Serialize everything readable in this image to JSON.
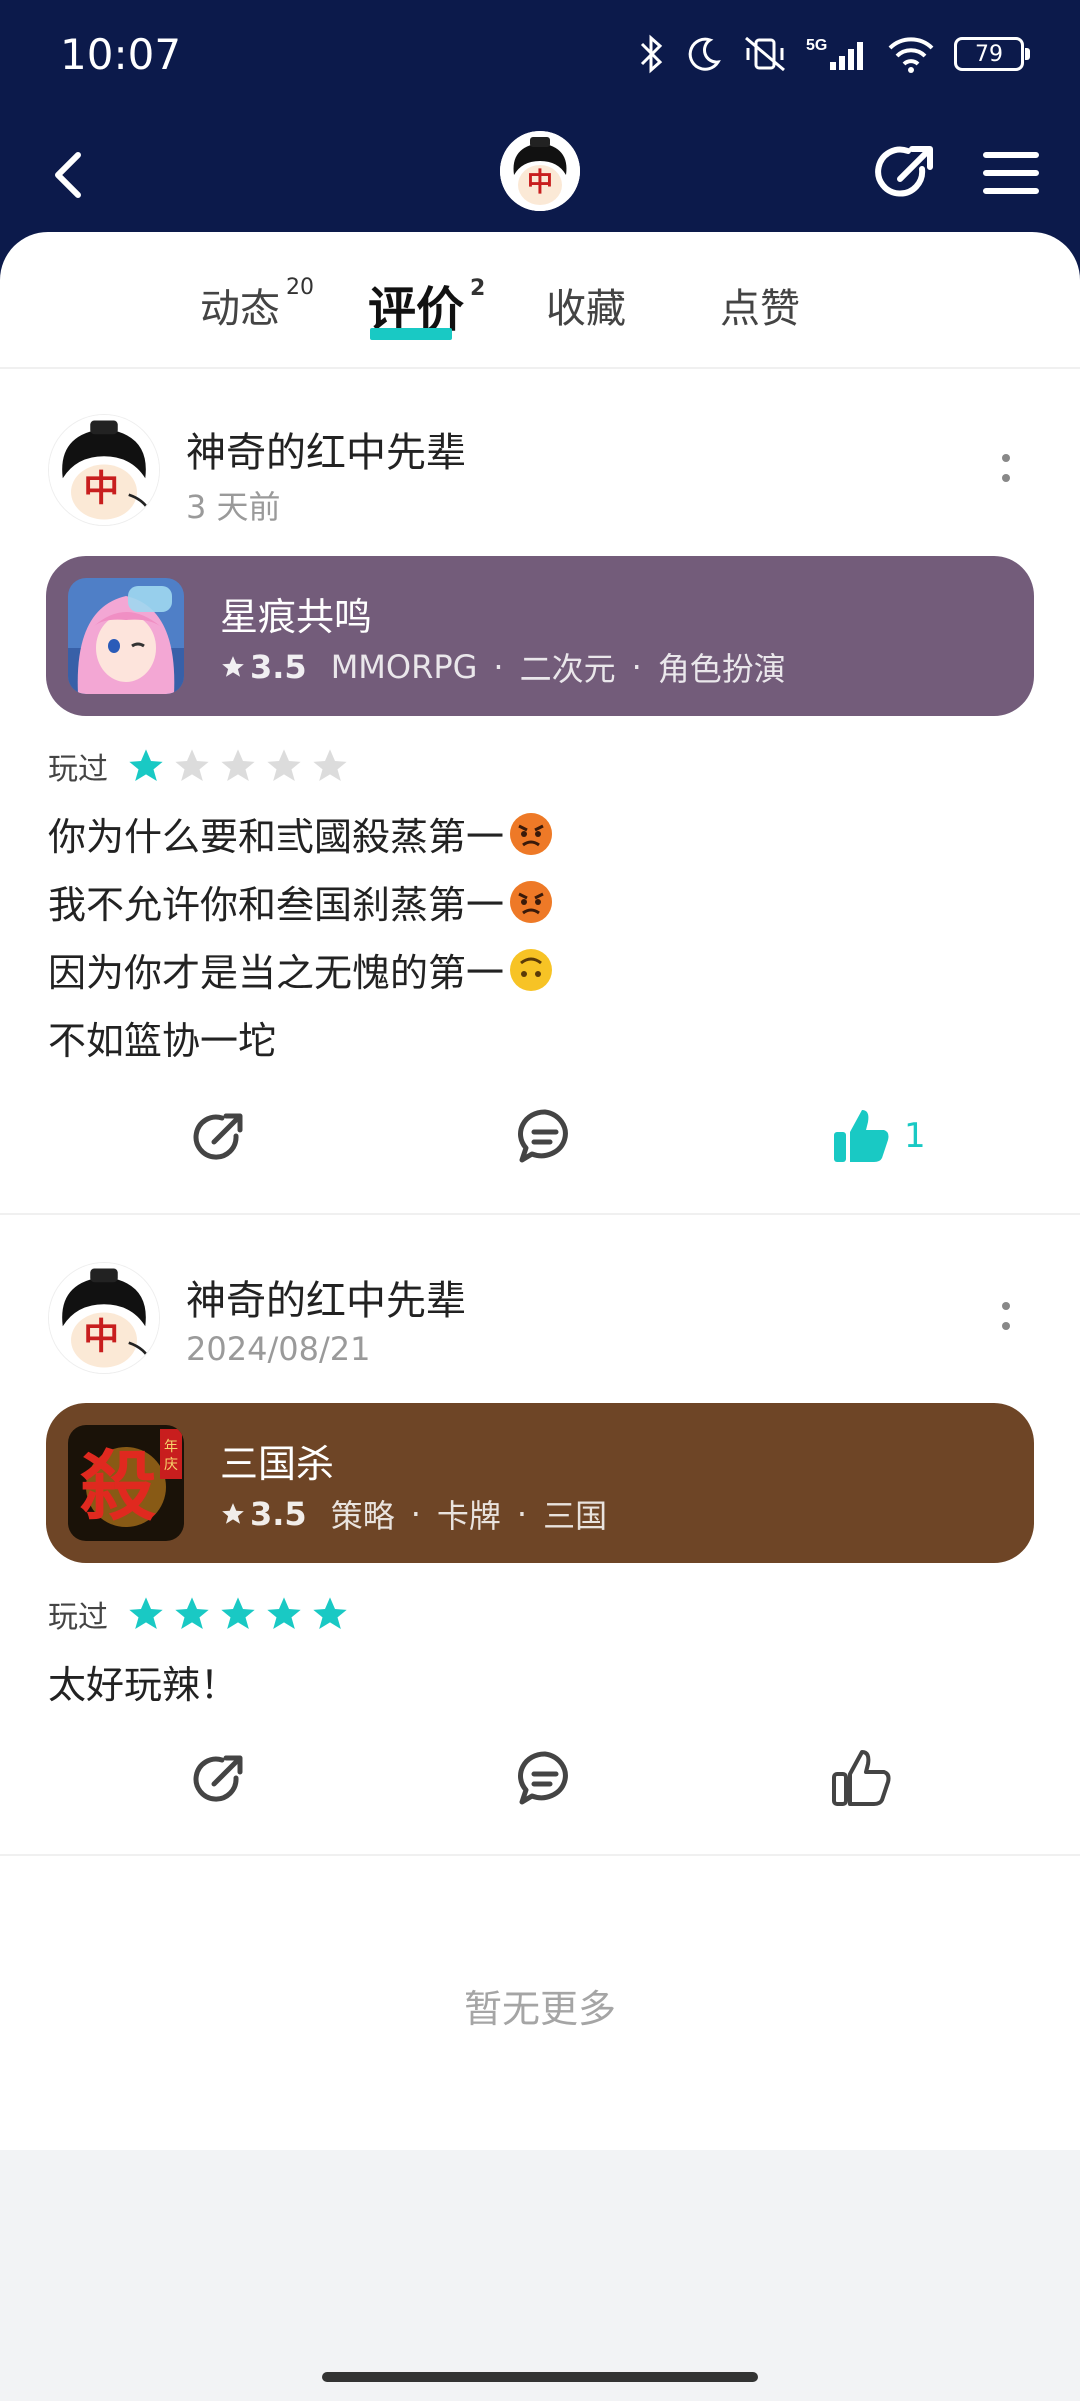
{
  "status_bar": {
    "time": "10:07",
    "battery": "79",
    "network": "5G"
  },
  "header": {
    "share_icon": "share-icon",
    "menu_icon": "menu-icon"
  },
  "tabs": [
    {
      "label": "动态",
      "count": "20"
    },
    {
      "label": "评价",
      "count": "2"
    },
    {
      "label": "收藏",
      "count": ""
    },
    {
      "label": "点赞",
      "count": ""
    }
  ],
  "active_tab": "评价",
  "reviews": [
    {
      "username": "神奇的红中先辈",
      "date": "3 天前",
      "game": {
        "name": "星痕共鸣",
        "score": "3.5",
        "tags": [
          "MMORPG",
          "二次元",
          "角色扮演"
        ],
        "card_color": "#735c7a"
      },
      "played_label": "玩过",
      "rating": 1,
      "lines": [
        {
          "text": "你为什么要和弎國殺蒸第一",
          "emoji": "angry"
        },
        {
          "text": "我不允许你和叁国刹蒸第一",
          "emoji": "angry"
        },
        {
          "text": "因为你才是当之无愧的第一",
          "emoji": "upside-down"
        },
        {
          "text": "不如篮协一坨",
          "emoji": ""
        }
      ],
      "likes": "1",
      "liked": true
    },
    {
      "username": "神奇的红中先辈",
      "date": "2024/08/21",
      "game": {
        "name": "三国杀",
        "score": "3.5",
        "tags": [
          "策略",
          "卡牌",
          "三国"
        ],
        "card_color": "#6e4526"
      },
      "played_label": "玩过",
      "rating": 5,
      "lines": [
        {
          "text": "太好玩辣！",
          "emoji": ""
        }
      ],
      "likes": "",
      "liked": false
    }
  ],
  "footer": {
    "no_more": "暂无更多"
  },
  "colors": {
    "header_bg": "#0c1a4b",
    "accent": "#19c9c4"
  }
}
